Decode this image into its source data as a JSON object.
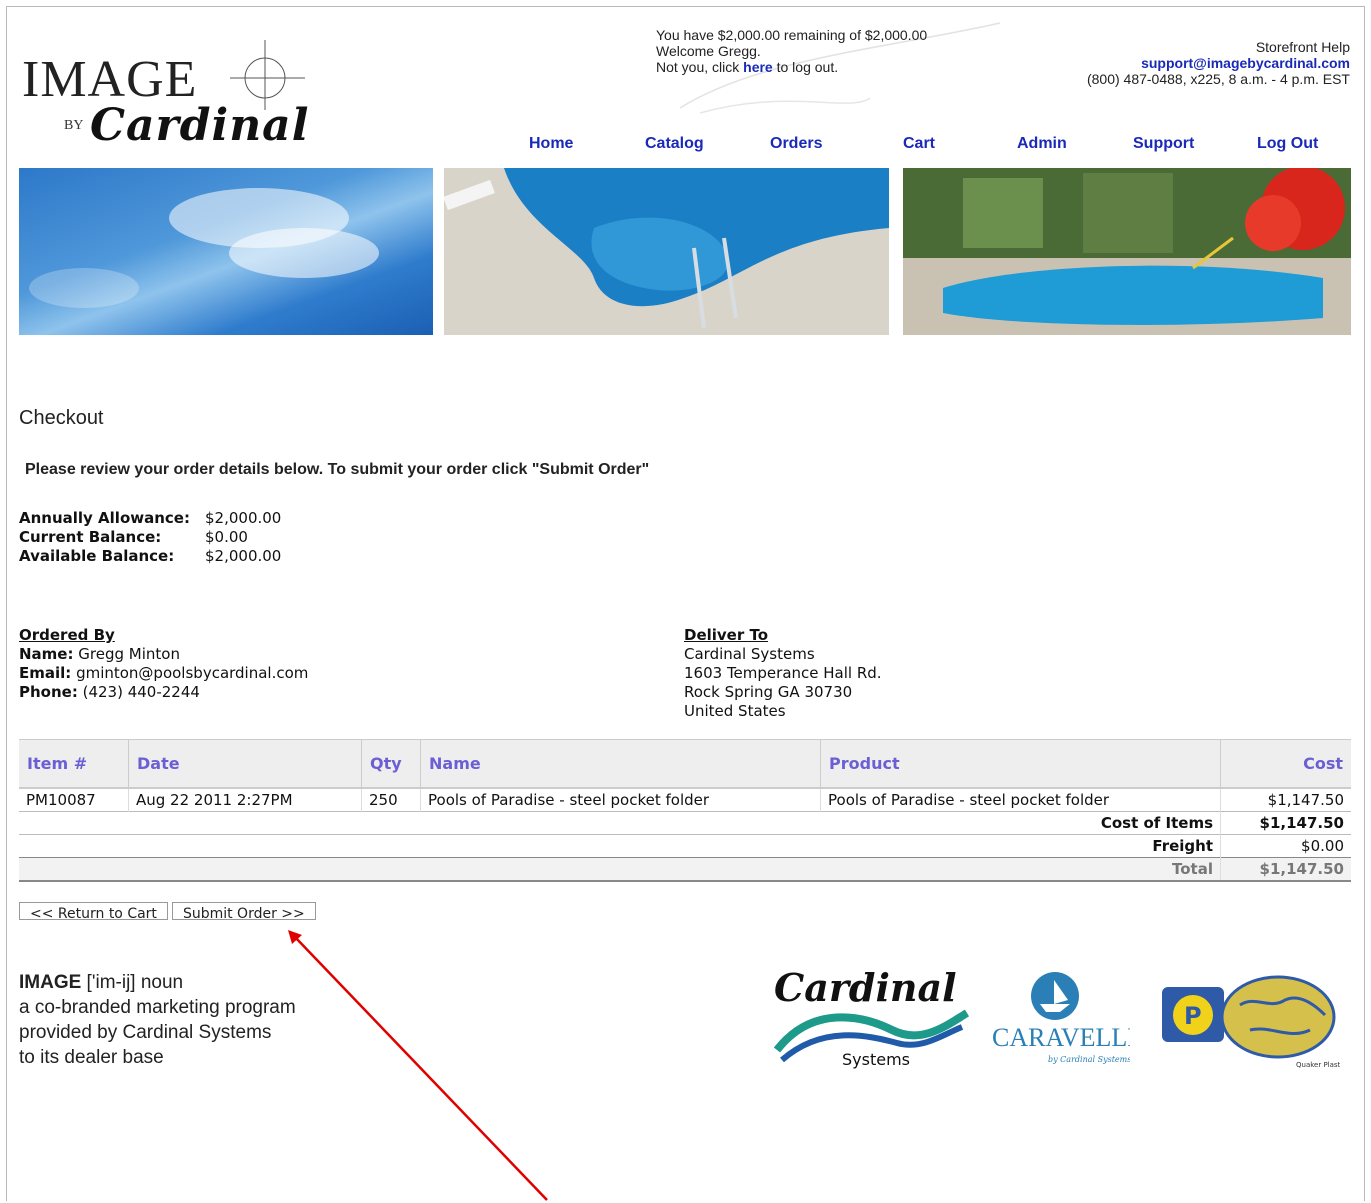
{
  "logo": {
    "main": "IMAGE",
    "by": "BY",
    "script": "Cardinal"
  },
  "account": {
    "balance_line": "You have $2,000.00 remaining of $2,000.00",
    "welcome": "Welcome Gregg.",
    "not_you_prefix": "Not you, click ",
    "here_link": "here",
    "not_you_suffix": " to log out."
  },
  "help": {
    "title": "Storefront Help",
    "email": "support@imagebycardinal.com",
    "phone": "(800) 487-0488, x225, 8 a.m. - 4 p.m. EST"
  },
  "nav": [
    "Home",
    "Catalog",
    "Orders",
    "Cart",
    "Admin",
    "Support",
    "Log Out"
  ],
  "checkout": {
    "title": "Checkout",
    "instructions": "Please review your order details below. To submit your order click \"Submit Order\""
  },
  "allowance": [
    {
      "label": "Annually Allowance:",
      "value": "$2,000.00"
    },
    {
      "label": "Current Balance:",
      "value": "$0.00"
    },
    {
      "label": "Available Balance:",
      "value": "$2,000.00"
    }
  ],
  "ordered_by": {
    "heading": "Ordered By",
    "name_label": "Name:",
    "name": "Gregg Minton",
    "email_label": "Email:",
    "email": "gminton@poolsbycardinal.com",
    "phone_label": "Phone:",
    "phone": "(423) 440-2244"
  },
  "deliver_to": {
    "heading": "Deliver To",
    "lines": [
      "Cardinal Systems",
      "1603 Temperance Hall Rd.",
      "Rock Spring GA 30730",
      "United States"
    ]
  },
  "table": {
    "headers": [
      "Item #",
      "Date",
      "Qty",
      "Name",
      "Product",
      "Cost"
    ],
    "rows": [
      [
        "PM10087",
        "Aug 22 2011 2:27PM",
        "250",
        "Pools of Paradise - steel pocket folder",
        "Pools of Paradise - steel pocket folder",
        "$1,147.50"
      ]
    ],
    "summary": [
      {
        "label": "Cost of Items",
        "value": "$1,147.50"
      },
      {
        "label": "Freight",
        "value": "$0.00"
      },
      {
        "label": "Total",
        "value": "$1,147.50"
      }
    ]
  },
  "buttons": {
    "return": "<< Return to Cart",
    "submit": "Submit Order >>"
  },
  "definition": {
    "word": "IMAGE",
    "pron": " ['im-ij] noun",
    "lines": [
      "a co-branded marketing program",
      "provided by Cardinal Systems",
      "to its dealer base"
    ]
  },
  "partner_logos": {
    "cardinal": {
      "script": "Cardinal",
      "sub": "Systems"
    },
    "caravelle": {
      "name": "CARAVELLE",
      "sub": "by Cardinal Systems"
    },
    "quaker": {
      "name": "Quaker Plastics"
    }
  },
  "colors": {
    "link": "#1a2ab8",
    "header_text": "#6b5fd4",
    "annotation_arrow": "#e00000"
  }
}
